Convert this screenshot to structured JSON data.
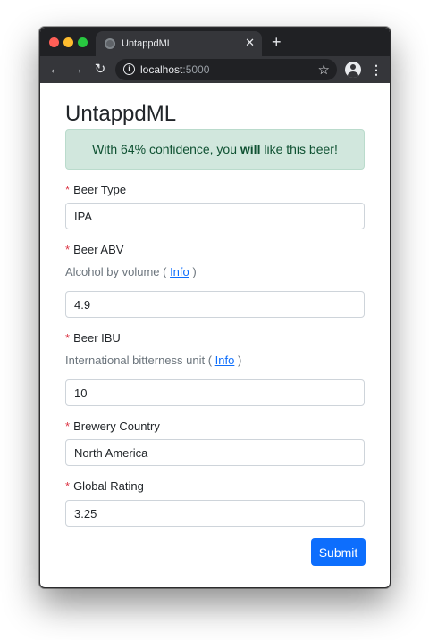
{
  "browser": {
    "tab_title": "UntappdML",
    "close_glyph": "✕",
    "new_tab_glyph": "+",
    "url_host": "localhost",
    "url_port": ":5000"
  },
  "page": {
    "title": "UntappdML",
    "alert": {
      "prefix": "With 64% confidence, you ",
      "emphasis": "will",
      "suffix": " like this beer!",
      "bg_color": "#d1e7dd",
      "text_color": "#0f5132"
    },
    "required_marker": "*",
    "fields": {
      "beer_type": {
        "label": "Beer Type",
        "value": "IPA"
      },
      "beer_abv": {
        "label": "Beer ABV",
        "help_prefix": "Alcohol by volume ( ",
        "help_link": "Info",
        "help_suffix": " )",
        "value": "4.9"
      },
      "beer_ibu": {
        "label": "Beer IBU",
        "help_prefix": "International bitterness unit ( ",
        "help_link": "Info",
        "help_suffix": " )",
        "value": "10"
      },
      "brewery_country": {
        "label": "Brewery Country",
        "value": "North America"
      },
      "global_rating": {
        "label": "Global Rating",
        "value": "3.25"
      }
    },
    "submit_label": "Submit",
    "accent_color": "#0d6efd"
  }
}
